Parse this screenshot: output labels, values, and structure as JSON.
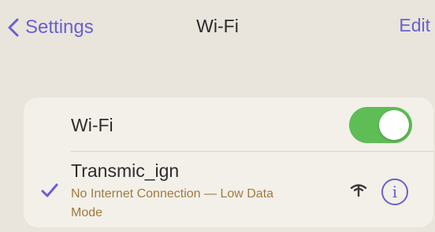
{
  "nav": {
    "back_label": "Settings",
    "title": "Wi-Fi",
    "edit_label": "Edit"
  },
  "wifi_row": {
    "label": "Wi-Fi",
    "toggle_on": true
  },
  "network": {
    "name": "Transmic_ign",
    "status": "No Internet Connection — Low Data Mode",
    "selected": true,
    "info_glyph": "i"
  },
  "icons": {
    "back": "chevron-left-icon",
    "check": "checkmark-icon",
    "signal": "wifi-no-internet-icon",
    "info": "info-circle-icon"
  },
  "colors": {
    "accent": "#6b5fd0",
    "toggle_on": "#5fbd56",
    "warning_text": "#a07a3c",
    "background": "#e9e5dc",
    "card": "#f3f0e9"
  }
}
